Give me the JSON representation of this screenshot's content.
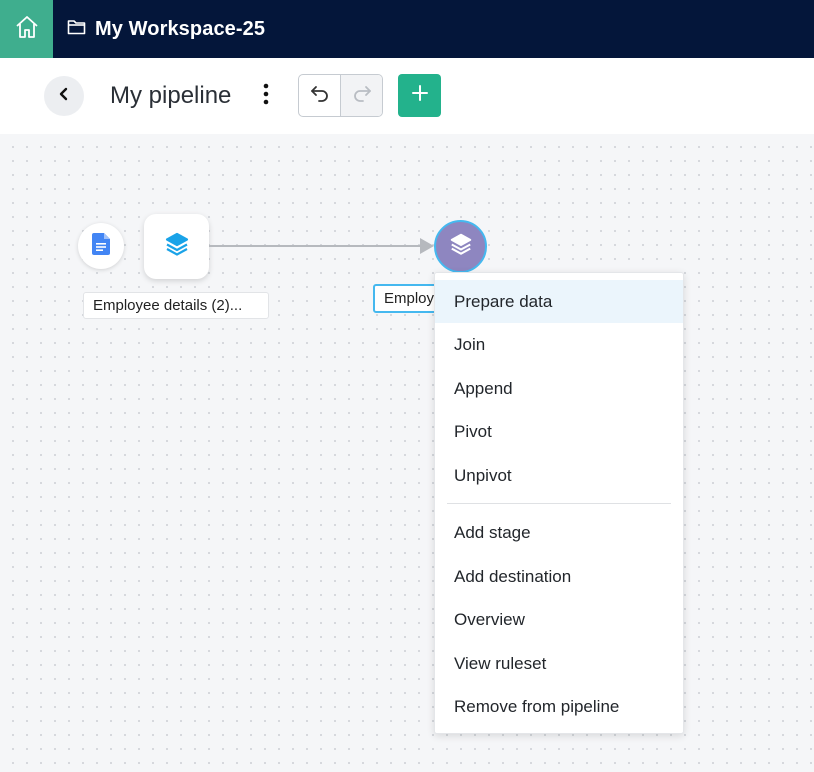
{
  "topbar": {
    "home_icon": "home-icon",
    "folder_icon": "folder-icon",
    "workspace_title": "My Workspace-25"
  },
  "toolbar": {
    "back_icon": "chevron-left-icon",
    "pipeline_title": "My pipeline",
    "more_icon": "more-vertical-icon",
    "undo_icon": "undo-icon",
    "redo_icon": "redo-icon",
    "add_icon": "plus-icon"
  },
  "canvas": {
    "source_node_icon": "document-icon",
    "dataset_node_icon": "layers-icon",
    "stage_node_icon": "layers-icon",
    "source_label": "Employee details (2)...",
    "stage_label": "Employ"
  },
  "context_menu": {
    "items": [
      {
        "label": "Prepare data"
      },
      {
        "label": "Join"
      },
      {
        "label": "Append"
      },
      {
        "label": "Pivot"
      },
      {
        "label": "Unpivot"
      },
      {
        "label": "Add stage"
      },
      {
        "label": "Add destination"
      },
      {
        "label": "Overview"
      },
      {
        "label": "View ruleset"
      },
      {
        "label": "Remove from pipeline"
      }
    ]
  },
  "colors": {
    "topbar_bg": "#04163a",
    "home_bg": "#3fae8e",
    "accent_green": "#23b28c",
    "stage_node": "#8e86c0",
    "selection_blue": "#45b8ef",
    "menu_highlight": "#ebf5fc"
  }
}
